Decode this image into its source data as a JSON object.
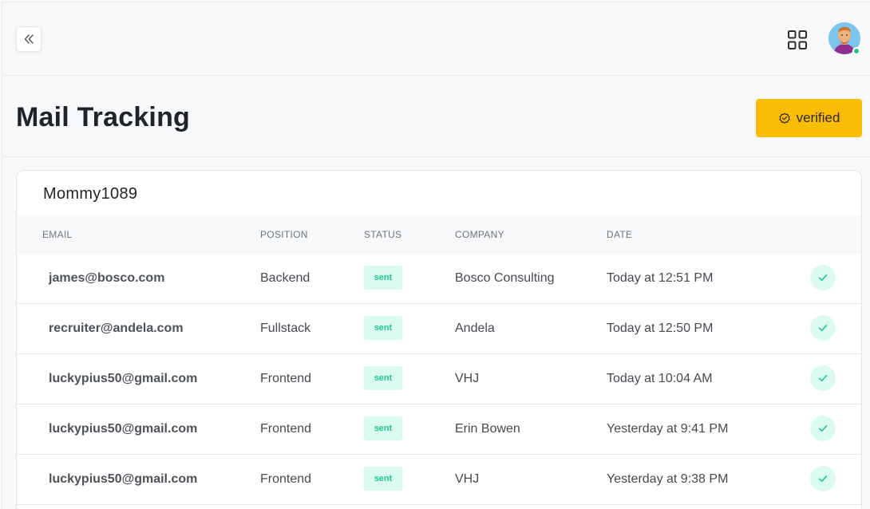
{
  "header": {
    "avatar_alt": "user avatar"
  },
  "page": {
    "title": "Mail Tracking",
    "verified_label": "verified"
  },
  "card": {
    "title": "Mommy1089",
    "columns": [
      "EMAIL",
      "POSITION",
      "STATUS",
      "COMPANY",
      "DATE"
    ],
    "rows": [
      {
        "email": "james@bosco.com",
        "position": "Backend",
        "status": "sent",
        "company": "Bosco Consulting",
        "date": "Today at 12:51 PM"
      },
      {
        "email": "recruiter@andela.com",
        "position": "Fullstack",
        "status": "sent",
        "company": "Andela",
        "date": "Today at 12:50 PM"
      },
      {
        "email": "luckypius50@gmail.com",
        "position": "Frontend",
        "status": "sent",
        "company": "VHJ",
        "date": "Today at 10:04 AM"
      },
      {
        "email": "luckypius50@gmail.com",
        "position": "Frontend",
        "status": "sent",
        "company": "Erin Bowen",
        "date": "Yesterday at 9:41 PM"
      },
      {
        "email": "luckypius50@gmail.com",
        "position": "Frontend",
        "status": "sent",
        "company": "VHJ",
        "date": "Yesterday at 9:38 PM"
      }
    ]
  },
  "colors": {
    "accent": "#fbbc05",
    "status_bg": "#dcfbf0",
    "status_text": "#22c58b",
    "online": "#22c58b"
  },
  "icons": {
    "collapse": "double-chevron-left-icon",
    "apps": "grid-icon",
    "verified": "badge-check-icon",
    "row_action": "check-icon"
  }
}
